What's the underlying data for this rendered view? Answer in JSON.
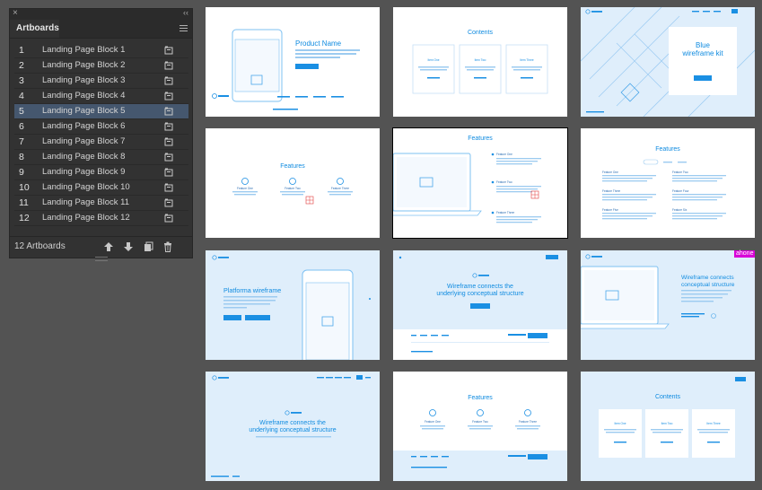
{
  "panel": {
    "close_glyph": "×",
    "collapse_glyph": "‹‹",
    "tab_label": "Artboards",
    "menu_icon": "hamburger-icon",
    "artboards": [
      {
        "num": "1",
        "name": "Landing Page Block 1"
      },
      {
        "num": "2",
        "name": "Landing Page Block 2"
      },
      {
        "num": "3",
        "name": "Landing Page Block 3"
      },
      {
        "num": "4",
        "name": "Landing Page Block 4"
      },
      {
        "num": "5",
        "name": "Landing Page Block 5",
        "selected": true
      },
      {
        "num": "6",
        "name": "Landing Page Block 6"
      },
      {
        "num": "7",
        "name": "Landing Page Block 7"
      },
      {
        "num": "8",
        "name": "Landing Page Block 8"
      },
      {
        "num": "9",
        "name": "Landing Page Block 9"
      },
      {
        "num": "10",
        "name": "Landing Page Block 10"
      },
      {
        "num": "11",
        "name": "Landing Page Block 11"
      },
      {
        "num": "12",
        "name": "Landing Page Block 12"
      }
    ],
    "count_label": "12 Artboards",
    "footer_icons": [
      "arrow-up-icon",
      "arrow-down-icon",
      "new-artboard-icon",
      "trash-icon"
    ]
  },
  "artboards_canvas": {
    "ab1": {
      "title": "Product Name"
    },
    "ab2": {
      "title": "Contents",
      "items": [
        "Item One",
        "Item Two",
        "Item Three"
      ]
    },
    "ab3": {
      "title_line1": "Blue",
      "title_line2": "wireframe kit"
    },
    "ab4": {
      "title": "Features",
      "items": [
        "Feature One",
        "Feature Two",
        "Feature Three"
      ]
    },
    "ab5": {
      "title": "Features",
      "items": [
        "Feature One",
        "Feature Two",
        "Feature Three"
      ]
    },
    "ab6": {
      "title": "Features",
      "items": [
        "Feature One",
        "Feature Two",
        "Feature Three",
        "Feature Four",
        "Feature Five",
        "Feature Six"
      ]
    },
    "ab7": {
      "title": "Platforma wireframe"
    },
    "ab8": {
      "title_line1": "Wireframe connects the",
      "title_line2": "underlying conceptual structure"
    },
    "ab9": {
      "title_line1": "Wireframe connects",
      "title_line2": "conceptual structure"
    },
    "ab10": {
      "title_line1": "Wireframe connects the",
      "title_line2": "underlying conceptual structure"
    },
    "ab11": {
      "title": "Features",
      "items": [
        "Feature One",
        "Feature Two",
        "Feature Three"
      ]
    },
    "ab12": {
      "title": "Contents",
      "items": [
        "Item One",
        "Item Two",
        "Item Three"
      ]
    }
  },
  "host_label": "ahone",
  "colors": {
    "accent": "#0f8be0",
    "panel_bg": "#323232",
    "selection": "#45576e",
    "canvas": "#535353"
  }
}
